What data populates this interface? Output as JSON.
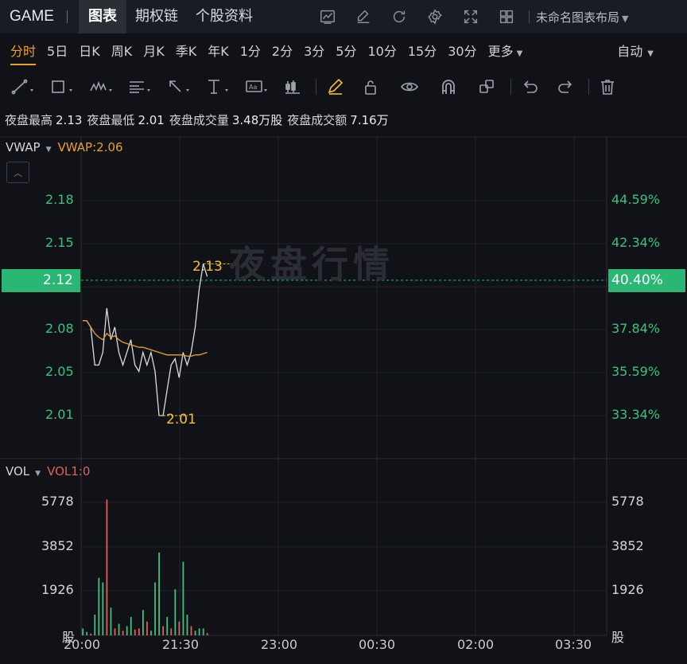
{
  "header": {
    "ticker": "GAME",
    "tabs": [
      {
        "label": "图表",
        "active": true
      },
      {
        "label": "期权链",
        "active": false
      },
      {
        "label": "个股资料",
        "active": false
      }
    ],
    "icons": [
      "line-chart-icon",
      "edit-icon",
      "refresh-icon",
      "gear-icon",
      "fullscreen-icon",
      "grid-layout-icon"
    ],
    "layout_name": "未命名图表布局"
  },
  "periods": {
    "items": [
      "分时",
      "5日",
      "日K",
      "周K",
      "月K",
      "季K",
      "年K",
      "1分",
      "2分",
      "3分",
      "5分",
      "10分",
      "15分",
      "30分"
    ],
    "active": "分时",
    "more_label": "更多",
    "auto_label": "自动"
  },
  "toolbar": {
    "tools": [
      "trend-line-icon",
      "rectangle-icon",
      "wave-pattern-icon",
      "fib-retracement-icon",
      "arrow-icon",
      "text-tool-icon",
      "annotation-icon",
      "candle-marker-icon",
      "pencil-icon",
      "lock-icon",
      "eye-icon",
      "magnet-icon",
      "layers-icon",
      "undo-icon",
      "redo-icon",
      "trash-icon"
    ]
  },
  "stats": {
    "high_label": "夜盘最高",
    "high": "2.13",
    "low_label": "夜盘最低",
    "low": "2.01",
    "volume_label": "夜盘成交量",
    "volume": "3.48万股",
    "turnover_label": "夜盘成交额",
    "turnover": "7.16万"
  },
  "price_panel": {
    "indicator": "VWAP",
    "indicator_value": "VWAP:2.06",
    "watermark": "夜盘行情",
    "price_ticks": [
      "2.18",
      "2.15",
      "2.08",
      "2.05",
      "2.01"
    ],
    "pct_ticks": [
      "44.59%",
      "42.34%",
      "37.84%",
      "35.59%",
      "33.34%"
    ],
    "current_price": "2.12",
    "current_pct": "40.40%",
    "high_marker": "2.13",
    "low_marker": "2.01"
  },
  "volume_panel": {
    "indicator": "VOL",
    "indicator_value": "VOL1:0",
    "ticks": [
      "5778",
      "3852",
      "1926"
    ],
    "unit": "股"
  },
  "time_axis": [
    "20:00",
    "21:30",
    "23:00",
    "00:30",
    "02:00",
    "03:30"
  ],
  "colors": {
    "up": "#3fc07e",
    "down": "#e0605a",
    "vwap": "#e8a030",
    "price_line": "#d9dce0",
    "marker": "#f0c030",
    "accent": "#f0a020"
  },
  "chart_data": {
    "type": "line",
    "x_range": [
      "20:00",
      "03:30"
    ],
    "price": [
      2.085,
      2.085,
      2.08,
      2.05,
      2.05,
      2.06,
      2.095,
      2.07,
      2.08,
      2.06,
      2.05,
      2.06,
      2.07,
      2.05,
      2.045,
      2.06,
      2.05,
      2.06,
      2.045,
      2.01,
      2.01,
      2.03,
      2.05,
      2.055,
      2.04,
      2.06,
      2.05,
      2.06,
      2.08,
      2.11,
      2.13,
      2.12
    ],
    "vwap": [
      2.085,
      2.085,
      2.08,
      2.075,
      2.072,
      2.07,
      2.075,
      2.072,
      2.073,
      2.07,
      2.068,
      2.067,
      2.066,
      2.065,
      2.064,
      2.064,
      2.063,
      2.062,
      2.061,
      2.06,
      2.059,
      2.058,
      2.058,
      2.058,
      2.058,
      2.058,
      2.057,
      2.057,
      2.058,
      2.058,
      2.059,
      2.06
    ],
    "volume": [
      300,
      150,
      80,
      900,
      2500,
      2300,
      5900,
      1200,
      300,
      500,
      200,
      400,
      800,
      250,
      300,
      1100,
      600,
      200,
      2300,
      3600,
      400,
      800,
      300,
      2000,
      600,
      3200,
      900,
      400,
      200,
      300,
      300,
      100
    ],
    "volume_up": [
      true,
      true,
      false,
      true,
      true,
      true,
      false,
      true,
      false,
      true,
      false,
      true,
      true,
      false,
      false,
      true,
      false,
      true,
      true,
      true,
      false,
      true,
      false,
      true,
      false,
      true,
      true,
      false,
      true,
      true,
      true,
      false
    ],
    "price_axis": {
      "min": 1.98,
      "max": 2.2
    },
    "volume_axis": {
      "min": 0,
      "max": 7000
    }
  }
}
